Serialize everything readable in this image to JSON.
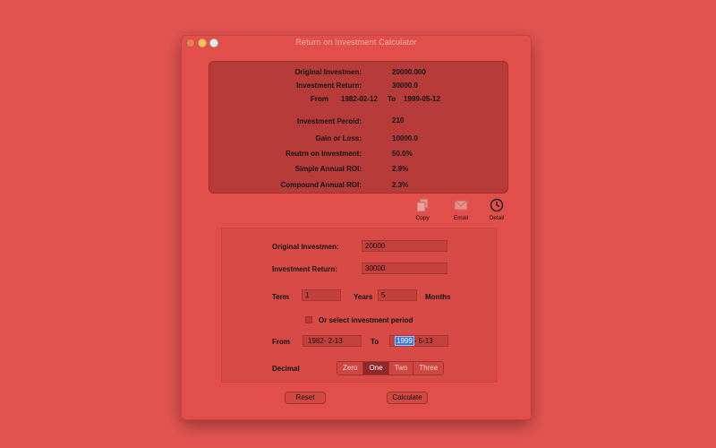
{
  "window": {
    "title": "Return on Investment Calculator"
  },
  "results": {
    "original_label": "Original Investmen:",
    "original_value": "20000.000",
    "return_label": "Investment Return:",
    "return_value": "30000.0",
    "from_label": "From",
    "from_value": "1982-02-12",
    "to_label": "To",
    "to_value": "1999-05-12",
    "period_label": "Investment Peroid:",
    "period_value": "210",
    "gain_label": "Gain or Loss:",
    "gain_value": "10000.0",
    "roi_label": "Reutrn on Investment:",
    "roi_value": "50.0%",
    "simple_label": "Simple Annual ROI:",
    "simple_value": "2.9%",
    "compound_label": "Compound Annual ROI:",
    "compound_value": "2.3%"
  },
  "toolbar": {
    "copy_label": "Copy",
    "email_label": "Email",
    "detail_label": "Detail"
  },
  "form": {
    "original_label": "Original Investmen:",
    "original_value": "20000",
    "return_label": "Investment Return:",
    "return_value": "30000",
    "term_label": "Term",
    "years_value": "1",
    "years_label": "Years",
    "months_value": "5",
    "months_label": "Months",
    "period_checkbox_label": "Or select investment period",
    "from_label": "From",
    "from_date": "1982- 2-13",
    "to_label": "To",
    "to_date_year": "1999",
    "to_date_rest": "- 5-13",
    "decimal_label": "Decimal",
    "decimal_options": [
      "Zero",
      "One",
      "Two",
      "Three"
    ],
    "decimal_selected": "One"
  },
  "buttons": {
    "reset_label": "Reset",
    "calculate_label": "Calculate"
  },
  "colors": {
    "background": "#e35450",
    "panel": "#b73c39",
    "selection": "#3a78d8"
  }
}
